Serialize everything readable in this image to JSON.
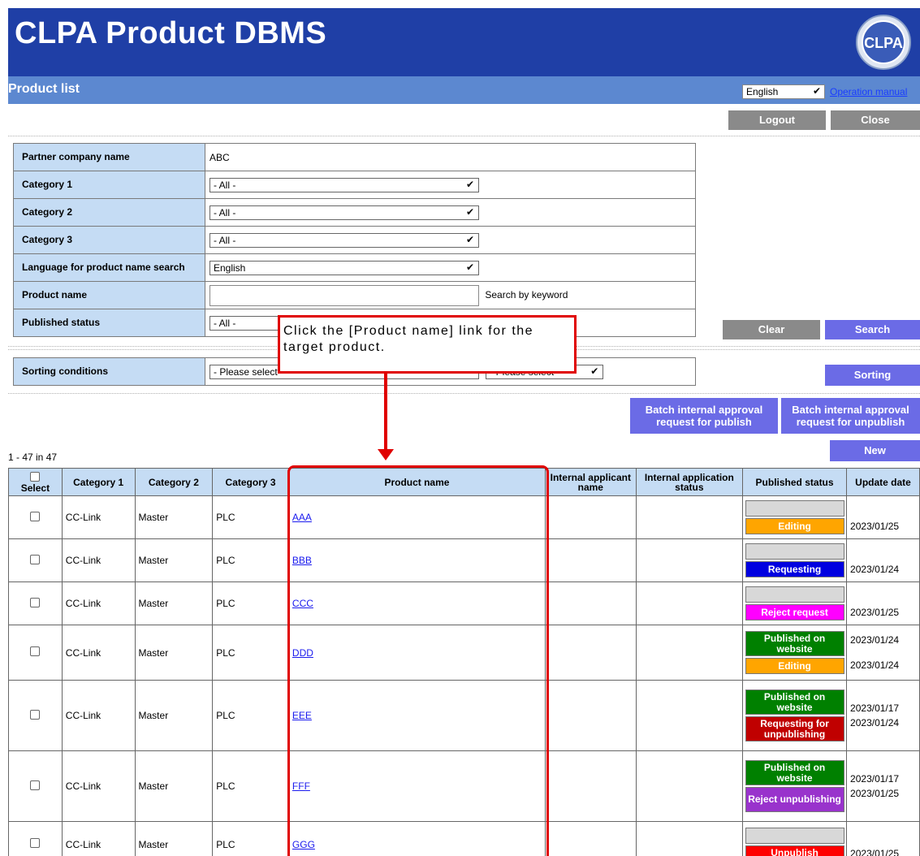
{
  "header": {
    "app_title": "CLPA Product DBMS",
    "logo_text": "CLPA"
  },
  "subbar": {
    "page_title": "Product list",
    "language": "English",
    "operation_manual": "Operation manual"
  },
  "top_buttons": {
    "logout": "Logout",
    "close": "Close"
  },
  "search_form": {
    "partner_label": "Partner company name",
    "partner_value": "ABC",
    "category1_label": "Category 1",
    "category1_value": "- All -",
    "category2_label": "Category 2",
    "category2_value": "- All -",
    "category3_label": "Category 3",
    "category3_value": "- All -",
    "lang_label": "Language for product name search",
    "lang_value": "English",
    "product_name_label": "Product name",
    "product_name_value": "",
    "keyword_hint": "Search by keyword",
    "published_label": "Published status",
    "published_value": "- All -",
    "clear": "Clear",
    "search": "Search"
  },
  "sorting": {
    "label": "Sorting conditions",
    "first_value": "- Please select -",
    "second_value": "- Please select -",
    "button": "Sorting"
  },
  "batch_buttons": {
    "publish": "Batch internal approval request for publish",
    "unpublish": "Batch internal approval request for unpublish"
  },
  "new_button": "New",
  "count_text": "1 - 47 in 47",
  "table": {
    "headers": {
      "select": "Select",
      "category1": "Category 1",
      "category2": "Category 2",
      "category3": "Category 3",
      "product_name": "Product name",
      "applicant": "Internal applicant name",
      "app_status": "Internal application status",
      "published_status": "Published status",
      "update_date": "Update date"
    },
    "rows": [
      {
        "cat1": "CC-Link",
        "cat2": "Master",
        "cat3": "PLC",
        "name": "AAA"
      },
      {
        "cat1": "CC-Link",
        "cat2": "Master",
        "cat3": "PLC",
        "name": "BBB"
      },
      {
        "cat1": "CC-Link",
        "cat2": "Master",
        "cat3": "PLC",
        "name": "CCC"
      },
      {
        "cat1": "CC-Link",
        "cat2": "Master",
        "cat3": "PLC",
        "name": "DDD"
      },
      {
        "cat1": "CC-Link",
        "cat2": "Master",
        "cat3": "PLC",
        "name": "EEE"
      },
      {
        "cat1": "CC-Link",
        "cat2": "Master",
        "cat3": "PLC",
        "name": "FFF"
      },
      {
        "cat1": "CC-Link",
        "cat2": "Master",
        "cat3": "PLC",
        "name": "GGG"
      }
    ],
    "statuses": {
      "editing": "Editing",
      "requesting": "Requesting",
      "reject_request": "Reject request",
      "published": "Published on website",
      "requesting_unpublishing": "Requesting for unpublishing",
      "reject_unpublishing": "Reject unpublishing",
      "unpublish": "Unpublish"
    },
    "dates": {
      "r1": "2023/01/25",
      "r2": "2023/01/24",
      "r3": "2023/01/25",
      "r4a": "2023/01/24",
      "r4b": "2023/01/24",
      "r5a": "2023/01/17",
      "r5b": "2023/01/24",
      "r6a": "2023/01/17",
      "r6b": "2023/01/25",
      "r7": "2023/01/25"
    }
  },
  "annotation": {
    "callout_text": "Click the [Product name] link for the target product."
  },
  "colors": {
    "banner": "#1f3fa6",
    "subbar": "#5c88d0",
    "label_bg": "#c5dcf4",
    "editing": "#ffa500",
    "requesting": "#0000e0",
    "reject_request": "#ff00ff",
    "published": "#008000",
    "requesting_unpublishing": "#c00000",
    "reject_unpublishing": "#9933cc",
    "unpublish": "#ff0000",
    "annotation": "#e00000"
  }
}
